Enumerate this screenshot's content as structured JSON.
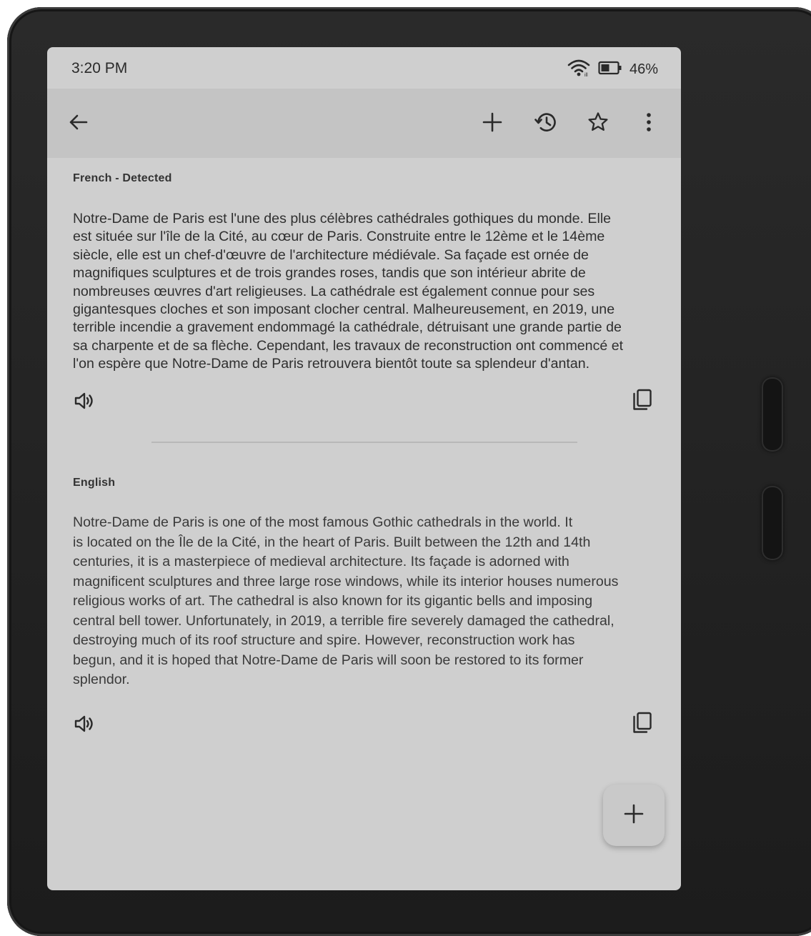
{
  "status_bar": {
    "time": "3:20 PM",
    "battery_percent": "46%",
    "wifi_icon": "wifi-icon",
    "battery_icon": "battery-icon"
  },
  "toolbar": {
    "back_icon": "arrow-back-icon",
    "add_icon": "plus-icon",
    "history_icon": "history-icon",
    "star_icon": "star-icon",
    "more_icon": "more-vertical-icon"
  },
  "source": {
    "language_label": "French - Detected",
    "text": "Notre-Dame de Paris est l'une des plus célèbres cathédrales gothiques du monde. Elle\nest située sur l'île de la Cité, au cœur de Paris. Construite entre le 12ème et le 14ème\nsiècle, elle est un chef-d'œuvre de l'architecture médiévale. Sa façade est ornée de\nmagnifiques sculptures et de trois grandes roses, tandis que son intérieur abrite de\nnombreuses œuvres d'art religieuses. La cathédrale est également connue pour ses\ngigantesques cloches et son imposant clocher central. Malheureusement, en 2019, une\nterrible incendie a gravement endommagé la cathédrale, détruisant une grande partie de\nsa charpente et de sa flèche. Cependant, les travaux de reconstruction ont commencé et\nl'on espère que Notre-Dame de Paris retrouvera bientôt toute sa splendeur d'antan.",
    "speaker_icon": "speaker-icon",
    "copy_icon": "copy-icon"
  },
  "target": {
    "language_label": "English",
    "text": "Notre-Dame de Paris is one of the most famous Gothic cathedrals in the world. It\nis located on the Île de la Cité, in the heart of Paris. Built between the 12th and 14th\ncenturies, it is a masterpiece of medieval architecture. Its façade is adorned with\nmagnificent sculptures and three large rose windows, while its interior houses numerous\nreligious works of art. The cathedral is also known for its gigantic bells and imposing\ncentral bell tower. Unfortunately, in 2019, a terrible fire severely damaged the cathedral,\ndestroying much of its roof structure and spire. However, reconstruction work has\nbegun, and it is hoped that Notre-Dame de Paris will soon be restored to its former\nsplendor.",
    "speaker_icon": "speaker-icon",
    "copy_icon": "copy-icon"
  },
  "fab": {
    "icon": "plus-icon"
  },
  "colors": {
    "screen_bg": "#cfcfcf",
    "toolbar_bg": "#c4c4c4",
    "bezel": "#1f1f1f"
  }
}
